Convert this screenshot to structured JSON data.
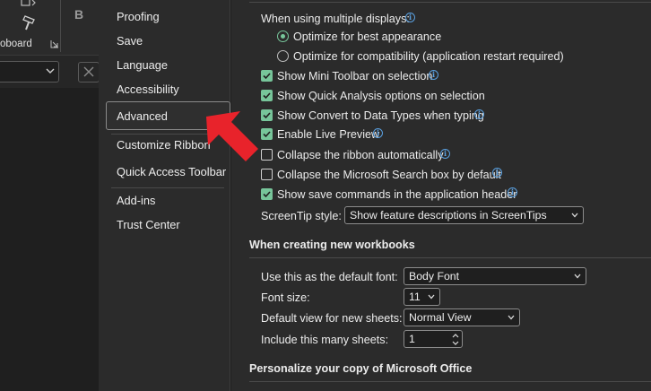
{
  "ribbon": {
    "clipboard_label": "oboard",
    "bold_label": "B"
  },
  "nav": {
    "items": [
      {
        "label": "Proofing"
      },
      {
        "label": "Save"
      },
      {
        "label": "Language"
      },
      {
        "label": "Accessibility"
      },
      {
        "label": "Advanced"
      },
      {
        "label": "Customize Ribbon"
      },
      {
        "label": "Quick Access Toolbar"
      },
      {
        "label": "Add-ins"
      },
      {
        "label": "Trust Center"
      }
    ],
    "selected": "Advanced"
  },
  "display": {
    "multiple_displays_label": "When using multiple displays:",
    "radio_best_appearance": "Optimize for best appearance",
    "radio_compatibility": "Optimize for compatibility (application restart required)",
    "options": [
      {
        "label": "Show Mini Toolbar on selection",
        "checked": true,
        "info": true
      },
      {
        "label": "Show Quick Analysis options on selection",
        "checked": true,
        "info": false
      },
      {
        "label": "Show Convert to Data Types when typing",
        "checked": true,
        "info": true
      },
      {
        "label": "Enable Live Preview",
        "checked": true,
        "info": true
      },
      {
        "label": "Collapse the ribbon automatically",
        "checked": false,
        "info": true
      },
      {
        "label": "Collapse the Microsoft Search box by default",
        "checked": false,
        "info": true
      },
      {
        "label": "Show save commands in the application header",
        "checked": true,
        "info": true
      }
    ],
    "screentip_label": "ScreenTip style:",
    "screentip_value": "Show feature descriptions in ScreenTips"
  },
  "new_workbooks": {
    "heading": "When creating new workbooks",
    "font_label": "Use this as the default font:",
    "font_value": "Body Font",
    "size_label": "Font size:",
    "size_value": "11",
    "view_label": "Default view for new sheets:",
    "view_value": "Normal View",
    "sheets_label": "Include this many sheets:",
    "sheets_value": "1"
  },
  "personalize": {
    "heading": "Personalize your copy of Microsoft Office"
  },
  "colors": {
    "accent_check": "#77c59a",
    "info_blue": "#5aa0e0",
    "arrow_red": "#e8232b"
  }
}
